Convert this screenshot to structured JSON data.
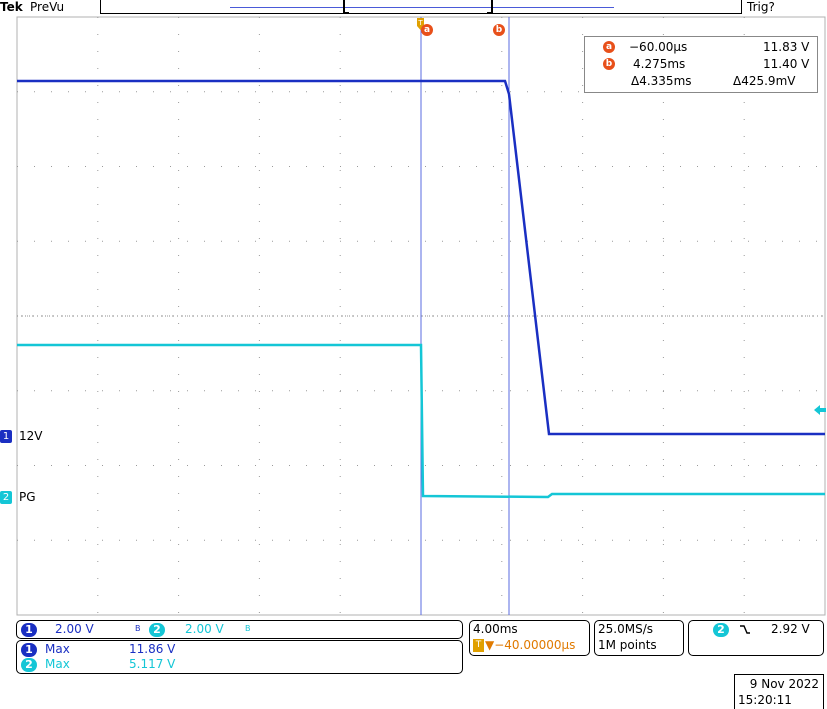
{
  "header": {
    "brand": "Tek",
    "mode": "PreVu",
    "trigger_status": "Trig?"
  },
  "cursors": {
    "a_label": "a",
    "b_label": "b",
    "readout": {
      "a_time": "−60.00µs",
      "a_volt": "11.83 V",
      "b_time": "4.275ms",
      "b_volt": "11.40 V",
      "delta_time": "Δ4.335ms",
      "delta_volt": "Δ425.9mV"
    }
  },
  "channels": {
    "ch1": {
      "number": "1",
      "label": "12V",
      "scale": "2.00 V",
      "bw": "B",
      "color": "#1a2fc2"
    },
    "ch2": {
      "number": "2",
      "label": "PG",
      "scale": "2.00 V",
      "bw": "B",
      "color": "#14c6d6"
    }
  },
  "measurements": [
    {
      "channel": "1",
      "name": "Max",
      "value": "11.86 V"
    },
    {
      "channel": "2",
      "name": "Max",
      "value": "5.117 V"
    }
  ],
  "horizontal": {
    "scale": "4.00ms",
    "trigger_position": "▼−40.00000µs",
    "trigger_marker": "T"
  },
  "acquisition": {
    "sample_rate": "25.0MS/s",
    "record_length": "1M points"
  },
  "trigger": {
    "source": "2",
    "slope": "falling",
    "level": "2.92 V"
  },
  "datetime": {
    "date": "9 Nov 2022",
    "time": "15:20:11"
  },
  "waveform_colors": {
    "ch1": "#1a2fc2",
    "ch2": "#14c6d6",
    "cursor": "#5a6be0",
    "grid": "#9a9a9a",
    "trigger": "#e07a00"
  }
}
